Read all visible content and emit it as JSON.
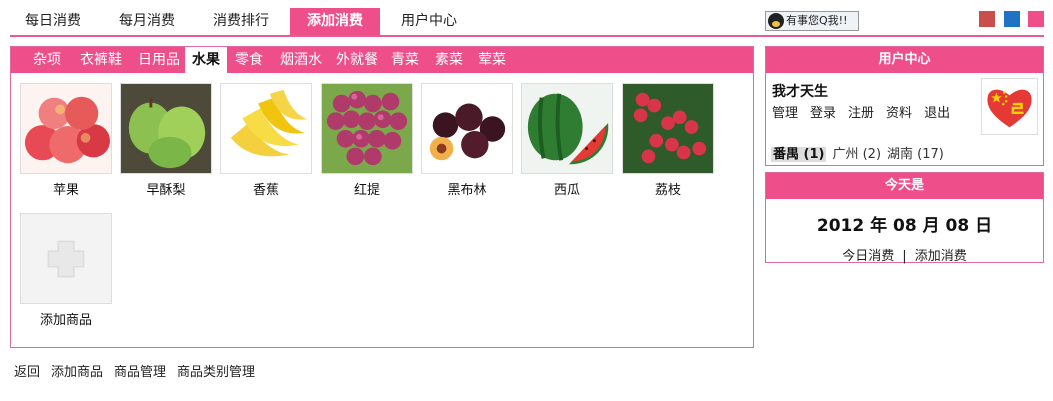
{
  "topnav": {
    "tabs": [
      {
        "label": "每日消费",
        "active": false
      },
      {
        "label": "每月消费",
        "active": false
      },
      {
        "label": "消费排行",
        "active": false
      },
      {
        "label": "添加消费",
        "active": true
      },
      {
        "label": "用户中心",
        "active": false
      }
    ],
    "qq_badge": "有事您Q我!!",
    "swatches": [
      "#c9504a",
      "#1e73c5",
      "#ee4f8b"
    ]
  },
  "categories": [
    {
      "label": "杂项",
      "active": false
    },
    {
      "label": "衣裤鞋",
      "active": false
    },
    {
      "label": "日用品",
      "active": false
    },
    {
      "label": "水果",
      "active": true
    },
    {
      "label": "零食",
      "active": false
    },
    {
      "label": "烟酒水",
      "active": false
    },
    {
      "label": "外就餐",
      "active": false
    },
    {
      "label": "青菜",
      "active": false
    },
    {
      "label": "素菜",
      "active": false
    },
    {
      "label": "荤菜",
      "active": false
    }
  ],
  "products": [
    {
      "name": "苹果",
      "icon": "apple-icon"
    },
    {
      "name": "早酥梨",
      "icon": "pear-icon"
    },
    {
      "name": "香蕉",
      "icon": "banana-icon"
    },
    {
      "name": "红提",
      "icon": "grape-icon"
    },
    {
      "name": "黑布林",
      "icon": "plum-icon"
    },
    {
      "name": "西瓜",
      "icon": "watermelon-icon"
    },
    {
      "name": "荔枝",
      "icon": "lychee-icon"
    }
  ],
  "add_product": {
    "name": "添加商品",
    "icon": "plus-icon"
  },
  "user_center": {
    "title": "用户中心",
    "username": "我才天生",
    "links": [
      "管理",
      "登录",
      "注册",
      "资料",
      "退出"
    ],
    "cities": [
      {
        "label": "番禺 (1)",
        "active": true
      },
      {
        "label": "广州 (2)",
        "active": false
      },
      {
        "label": "湖南 (17)",
        "active": false
      }
    ]
  },
  "today": {
    "title": "今天是",
    "date": "2012 年 08 月 08 日",
    "link_daily": "今日消费",
    "separator": "|",
    "link_add": "添加消费"
  },
  "footer": {
    "links": [
      "返回",
      "添加商品",
      "商品管理",
      "商品类别管理"
    ]
  }
}
